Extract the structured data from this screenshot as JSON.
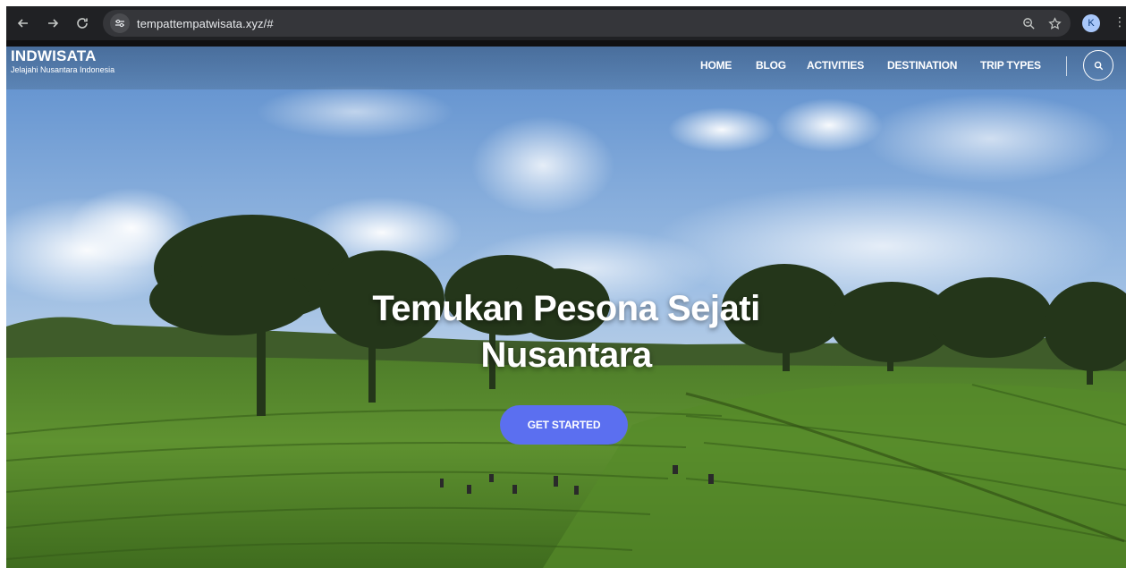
{
  "browser": {
    "url": "tempattempatwisata.xyz/#",
    "profile_initial": "K"
  },
  "site": {
    "brand": "INDWISATA",
    "tagline": "Jelajahi Nusantara Indonesia",
    "nav": [
      "HOME",
      "BLOG",
      "ACTIVITIES",
      "DESTINATION",
      "TRIP TYPES"
    ]
  },
  "hero": {
    "title_line1": "Temukan Pesona Sejati",
    "title_line2": "Nusantara",
    "cta_label": "GET STARTED"
  },
  "colors": {
    "cta": "#5b6ff0",
    "browser_bg": "#202124"
  }
}
